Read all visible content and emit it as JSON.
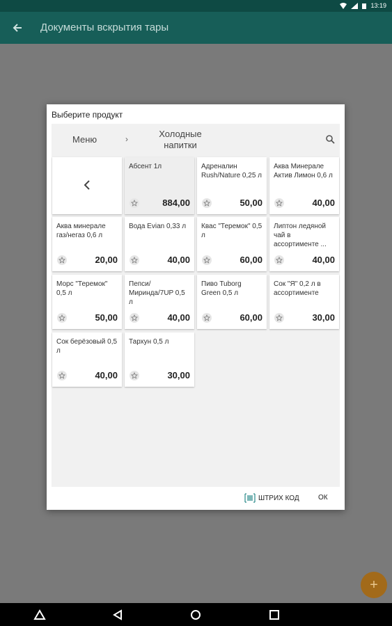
{
  "statusbar": {
    "time": "13:19"
  },
  "appbar": {
    "title": "Документы вскрытия тары"
  },
  "dialog": {
    "title": "Выберите продукт",
    "breadcrumb": {
      "menu": "Меню",
      "current": "Холодные напитки"
    },
    "products": [
      {
        "name": "Абсент 1л",
        "price": "884,00",
        "selected": true
      },
      {
        "name": "Адреналин Rush/Nature 0,25 л",
        "price": "50,00"
      },
      {
        "name": "Аква Минерале Актив Лимон 0,6 л",
        "price": "40,00"
      },
      {
        "name": "Аква минерале газ/негаз 0,6 л",
        "price": "20,00"
      },
      {
        "name": "Вода Evian 0,33 л",
        "price": "40,00"
      },
      {
        "name": "Квас \"Теремок\" 0,5 л",
        "price": "60,00"
      },
      {
        "name": "Липтон ледяной чай в ассортименте ...",
        "price": "40,00"
      },
      {
        "name": "Морс \"Теремок\" 0,5 л",
        "price": "50,00"
      },
      {
        "name": "Пепси/ Миринда/7UP 0,5 л",
        "price": "40,00"
      },
      {
        "name": "Пиво Tuborg Green 0,5 л",
        "price": "60,00"
      },
      {
        "name": "Сок \"Я\" 0,2 л в ассортименте",
        "price": "30,00"
      },
      {
        "name": "Сок берёзовый 0,5 л",
        "price": "40,00"
      },
      {
        "name": "Тархун 0,5 л",
        "price": "30,00"
      }
    ],
    "buttons": {
      "barcode": "ШТРИХ КОД",
      "ok": "ОК"
    }
  },
  "fab": {
    "label": "+"
  },
  "colors": {
    "appbar": "#175e58",
    "statusbar": "#0e4a44",
    "fab": "#a26a1a"
  }
}
